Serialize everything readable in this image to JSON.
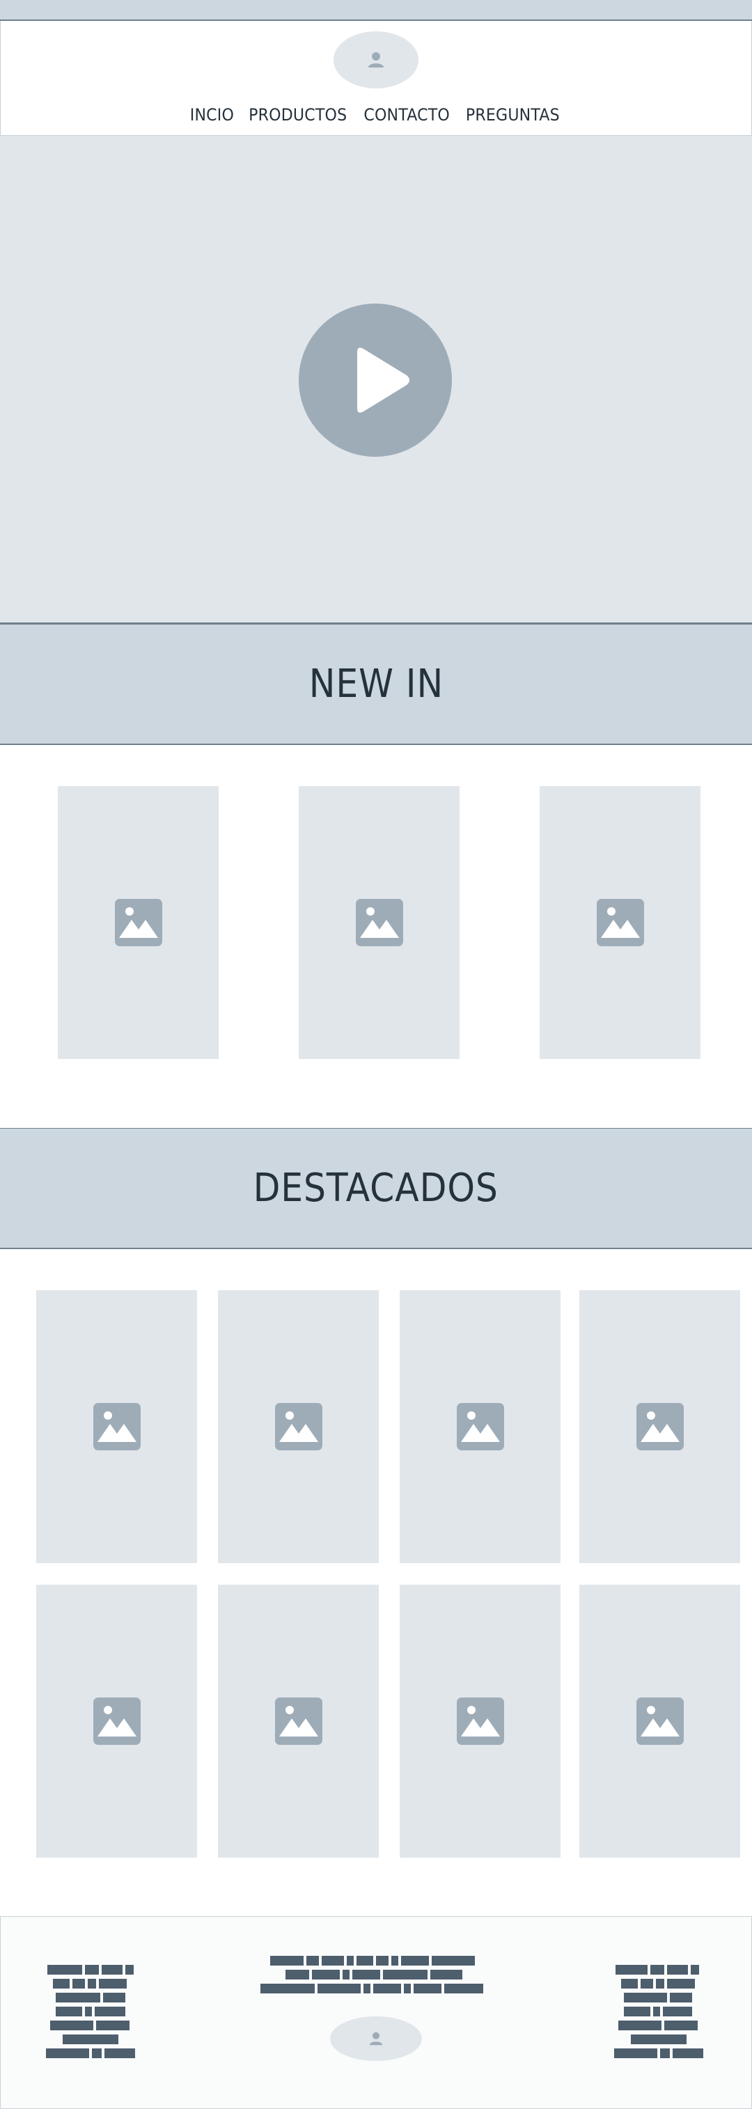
{
  "nav": {
    "items": [
      "INCIO",
      "PRODUCTOS",
      "CONTACTO",
      "PREGUNTAS"
    ]
  },
  "hero": {
    "icon": "play-icon"
  },
  "sections": {
    "new_in": {
      "title": "NEW IN",
      "product_count": 3
    },
    "featured": {
      "title": "DESTACADOS",
      "product_count": 8
    }
  },
  "icons": {
    "logo": "user-icon",
    "product": "image-placeholder-icon"
  },
  "colors": {
    "band": "#cdd7df",
    "placeholder": "#e1e6eb",
    "icon": "#9eacb8",
    "text": "#25313b",
    "border": "#6f7f8c"
  }
}
